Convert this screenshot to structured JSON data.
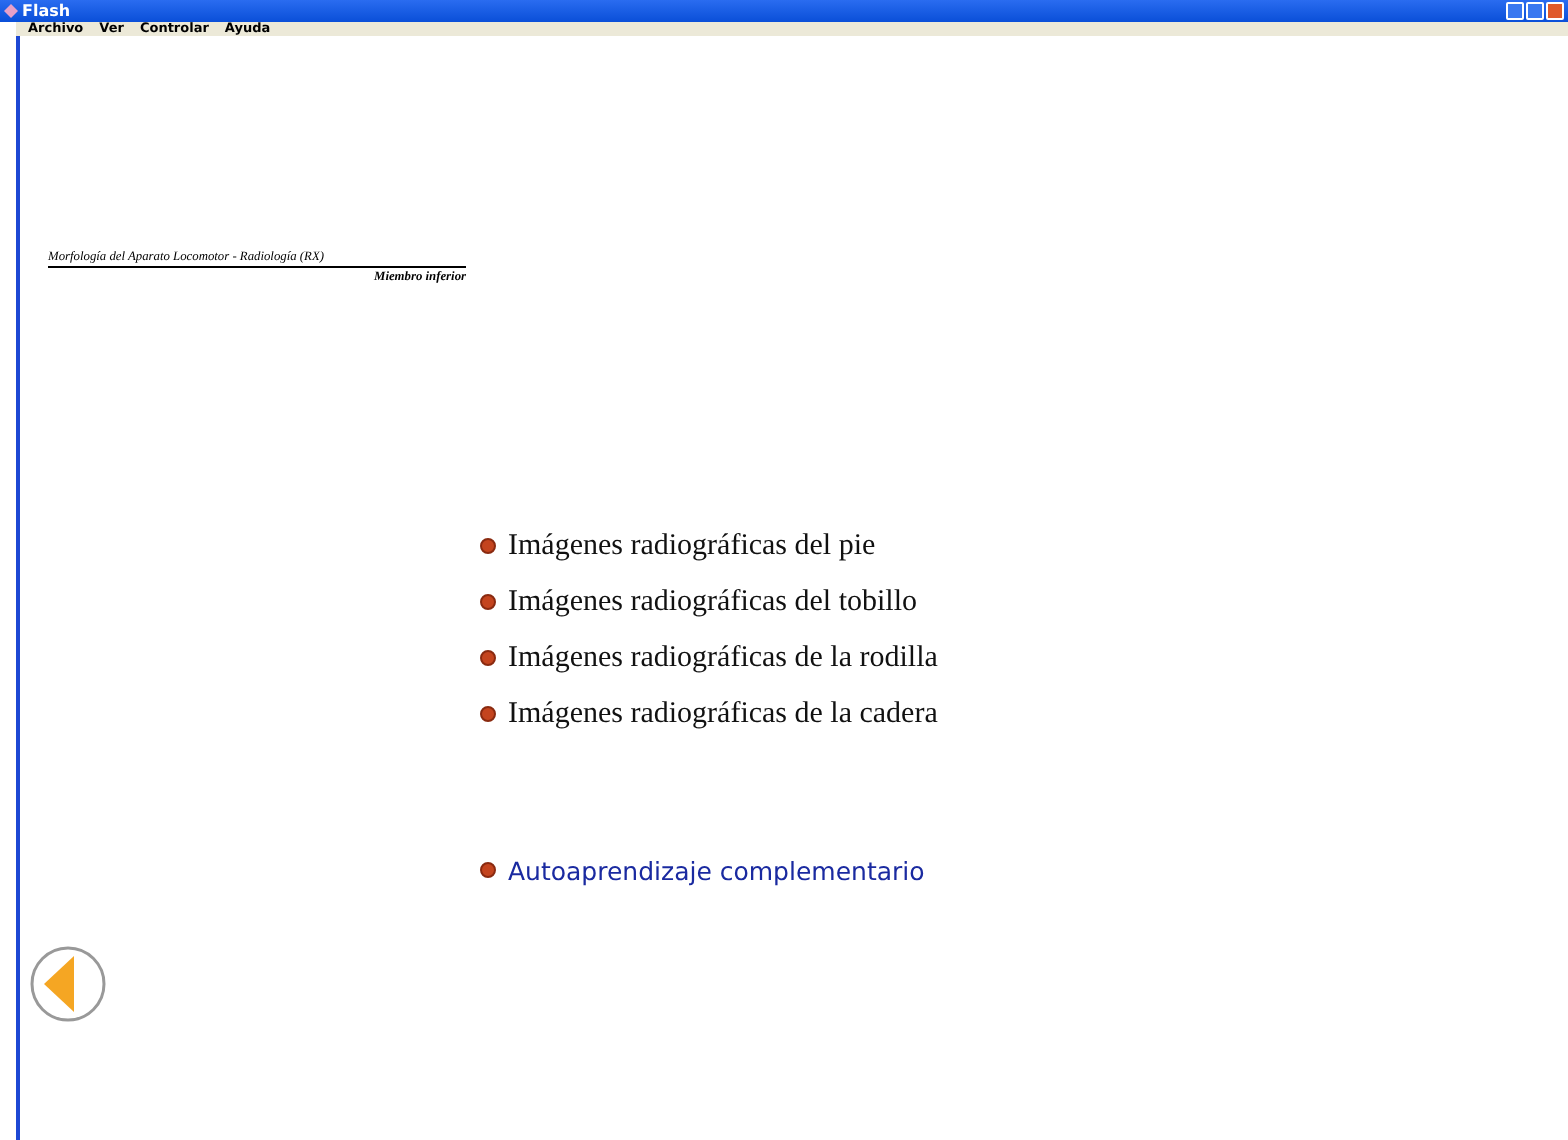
{
  "window": {
    "title": "Flash"
  },
  "menu": [
    "Archivo",
    "Ver",
    "Controlar",
    "Ayuda"
  ],
  "header": {
    "title": "Morfología del Aparato Locomotor - Radiología (RX)",
    "subtitle": "Miembro inferior"
  },
  "topics": [
    {
      "label": "Imágenes radiográficas del pie",
      "kind": "item"
    },
    {
      "label": "Imágenes radiográficas del tobillo",
      "kind": "item"
    },
    {
      "label": "Imágenes radiográficas de la rodilla",
      "kind": "item"
    },
    {
      "label": "Imágenes radiográficas de la cadera",
      "kind": "item"
    },
    {
      "label": "Autoaprendizaje complementario",
      "kind": "link"
    }
  ]
}
